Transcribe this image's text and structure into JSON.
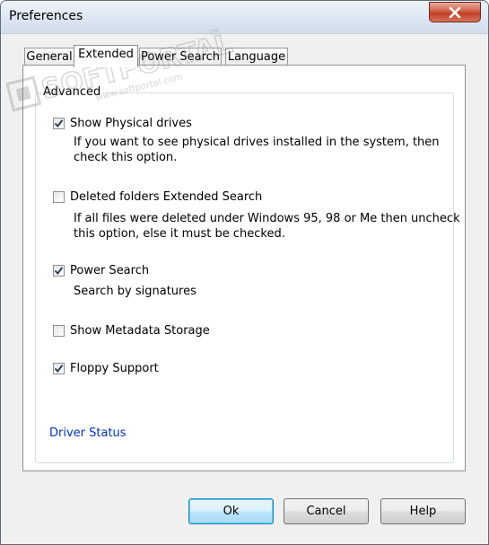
{
  "window": {
    "title": "Preferences"
  },
  "tabs": [
    {
      "label": "General",
      "active": false
    },
    {
      "label": "Extended",
      "active": true
    },
    {
      "label": "Power Search",
      "active": false
    },
    {
      "label": "Language",
      "active": false
    }
  ],
  "group": {
    "label": "Advanced"
  },
  "options": [
    {
      "label": "Show Physical drives",
      "checked": true,
      "description": [
        "If you want to see physical drives installed in the system, then",
        "check this option."
      ]
    },
    {
      "label": "Deleted folders Extended Search",
      "checked": false,
      "description": [
        "If all files were deleted under Windows 95, 98 or Me then uncheck",
        "this option, else it must be checked."
      ]
    },
    {
      "label": "Power Search",
      "checked": true,
      "description": [
        "Search by signatures"
      ]
    },
    {
      "label": "Show Metadata Storage",
      "checked": false,
      "description": []
    },
    {
      "label": "Floppy Support",
      "checked": true,
      "description": []
    }
  ],
  "link": {
    "label": "Driver Status"
  },
  "buttons": {
    "ok": "Ok",
    "cancel": "Cancel",
    "help": "Help"
  },
  "watermark": {
    "brand": "SOFTPORTAL",
    "url": "www.softportal.com",
    "mark": "TM"
  },
  "icons": {
    "close": "close-icon",
    "check": "checkmark-icon"
  },
  "colors": {
    "link": "#0033cc",
    "close_button": "#c8452c",
    "default_button_border": "#3c7fb1"
  }
}
